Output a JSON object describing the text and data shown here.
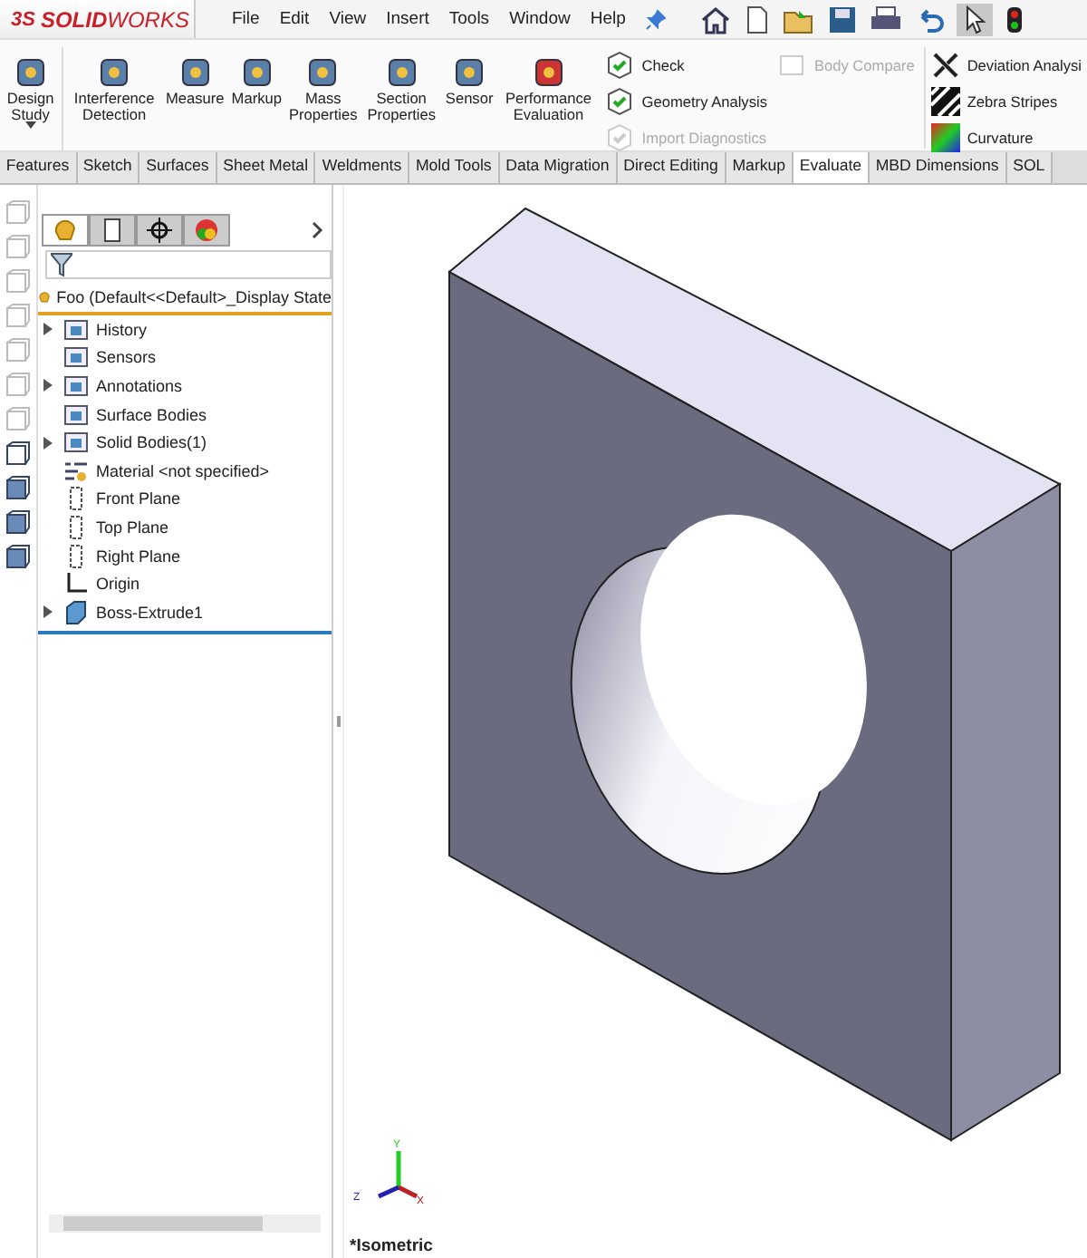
{
  "brand": {
    "prefix": "3S",
    "name_bold": "SOLID",
    "name_rest": "WORKS"
  },
  "menu": [
    "File",
    "Edit",
    "View",
    "Insert",
    "Tools",
    "Window",
    "Help"
  ],
  "ribbon": {
    "large_tools": [
      {
        "label": "Design Study",
        "dropdown": true
      },
      {
        "label": "Interference Detection",
        "dropdown": false
      },
      {
        "label": "Measure",
        "dropdown": false
      },
      {
        "label": "Markup",
        "dropdown": false
      },
      {
        "label": "Mass Properties",
        "dropdown": false
      },
      {
        "label": "Section Properties",
        "dropdown": false
      },
      {
        "label": "Sensor",
        "dropdown": false
      },
      {
        "label": "Performance Evaluation",
        "dropdown": false
      }
    ],
    "small_tools": [
      {
        "label": "Check",
        "disabled": false
      },
      {
        "label": "Geometry Analysis",
        "disabled": false
      },
      {
        "label": "Import Diagnostics",
        "disabled": true
      },
      {
        "label": "Body Compare",
        "disabled": true
      },
      {
        "label": "Deviation Analysi",
        "disabled": false
      },
      {
        "label": "Zebra Stripes",
        "disabled": false
      },
      {
        "label": "Curvature",
        "disabled": false
      }
    ]
  },
  "tabs": [
    {
      "label": "Features",
      "selected": false
    },
    {
      "label": "Sketch",
      "selected": false
    },
    {
      "label": "Surfaces",
      "selected": false
    },
    {
      "label": "Sheet Metal",
      "selected": false
    },
    {
      "label": "Weldments",
      "selected": false
    },
    {
      "label": "Mold Tools",
      "selected": false
    },
    {
      "label": "Data Migration",
      "selected": false
    },
    {
      "label": "Direct Editing",
      "selected": false
    },
    {
      "label": "Markup",
      "selected": false
    },
    {
      "label": "Evaluate",
      "selected": true
    },
    {
      "label": "MBD Dimensions",
      "selected": false
    },
    {
      "label": "SOL",
      "selected": false
    }
  ],
  "panel_tabs": [
    {
      "selected": true
    },
    {
      "selected": false
    },
    {
      "selected": false
    },
    {
      "selected": false
    }
  ],
  "tree": {
    "root": "Foo  (Default<<Default>_Display State",
    "items": [
      {
        "label": "History",
        "kind": "folder",
        "expandable": true
      },
      {
        "label": "Sensors",
        "kind": "folder",
        "expandable": false
      },
      {
        "label": "Annotations",
        "kind": "folder",
        "expandable": true
      },
      {
        "label": "Surface Bodies",
        "kind": "folder",
        "expandable": false
      },
      {
        "label": "Solid Bodies(1)",
        "kind": "folder",
        "expandable": true
      },
      {
        "label": "Material <not specified>",
        "kind": "material",
        "expandable": false
      },
      {
        "label": "Front Plane",
        "kind": "plane",
        "expandable": false
      },
      {
        "label": "Top Plane",
        "kind": "plane",
        "expandable": false
      },
      {
        "label": "Right Plane",
        "kind": "plane",
        "expandable": false
      },
      {
        "label": "Origin",
        "kind": "origin",
        "expandable": false
      },
      {
        "label": "Boss-Extrude1",
        "kind": "feature",
        "expandable": true
      }
    ]
  },
  "viewport": {
    "view_label": "*Isometric",
    "triad": {
      "x": "X",
      "y": "Y",
      "z": "Z"
    }
  }
}
